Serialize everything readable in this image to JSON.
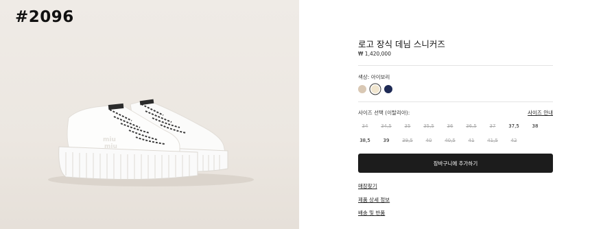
{
  "image_tag": "#2096",
  "product": {
    "title": "로고 장식 데님 스니커즈",
    "price": "₩ 1,420,000"
  },
  "color": {
    "label": "색상: 아이보리",
    "swatches": [
      {
        "name": "beige",
        "hex": "#d9c8b4",
        "selected": false
      },
      {
        "name": "ivory",
        "hex": "#f1e6cf",
        "selected": true
      },
      {
        "name": "navy",
        "hex": "#1e2a55",
        "selected": false
      }
    ]
  },
  "size": {
    "label": "사이즈 선택 (이탈리아):",
    "guide_link": "사이즈 안내",
    "options": [
      {
        "value": "34",
        "available": false
      },
      {
        "value": "34,5",
        "available": false
      },
      {
        "value": "35",
        "available": false
      },
      {
        "value": "35,5",
        "available": false
      },
      {
        "value": "36",
        "available": false
      },
      {
        "value": "36,5",
        "available": false
      },
      {
        "value": "37",
        "available": false
      },
      {
        "value": "37,5",
        "available": true
      },
      {
        "value": "38",
        "available": true
      },
      {
        "value": "38,5",
        "available": true
      },
      {
        "value": "39",
        "available": true
      },
      {
        "value": "39,5",
        "available": false
      },
      {
        "value": "40",
        "available": false
      },
      {
        "value": "40,5",
        "available": false
      },
      {
        "value": "41",
        "available": false
      },
      {
        "value": "41,5",
        "available": false
      },
      {
        "value": "42",
        "available": false
      }
    ]
  },
  "actions": {
    "add_to_cart": "장바구니에 추가하기",
    "links": [
      "매장찾기",
      "제품 상세 정보",
      "배송 및 반품"
    ]
  },
  "colors": {
    "photo_background": "#ece7e1",
    "button": "#1c1c1c",
    "sneaker": "#ffffff"
  }
}
